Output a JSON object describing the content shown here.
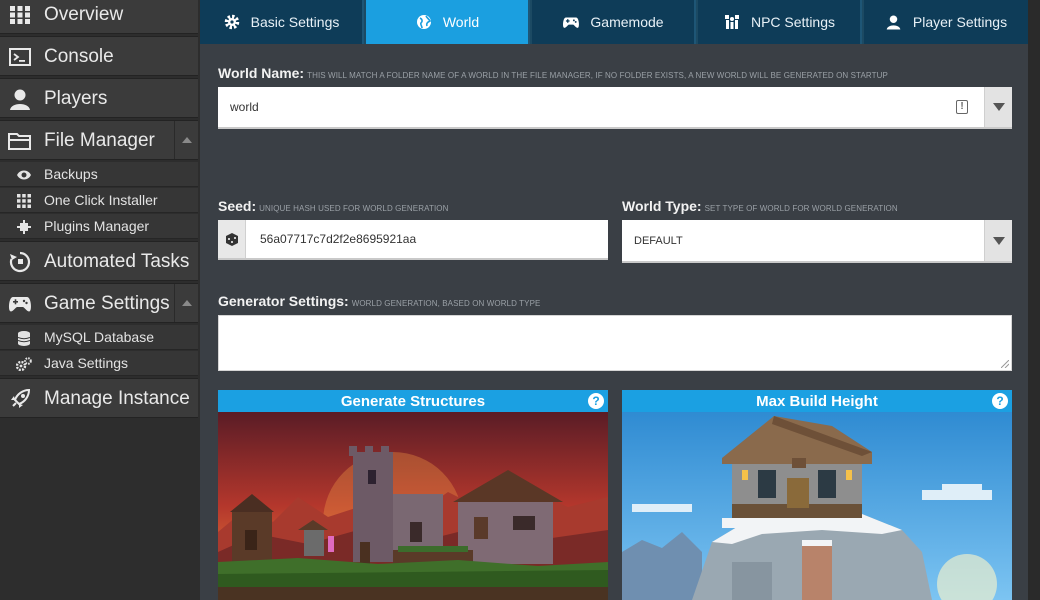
{
  "sidebar": {
    "items": [
      {
        "label": "Overview",
        "icon": "grid-icon"
      },
      {
        "label": "Console",
        "icon": "console-icon"
      },
      {
        "label": "Players",
        "icon": "user-icon"
      },
      {
        "label": "File Manager",
        "icon": "folder-icon"
      },
      {
        "label": "Automated Tasks",
        "icon": "tasks-icon"
      },
      {
        "label": "Game Settings",
        "icon": "gamepad-icon"
      },
      {
        "label": "Manage Instance",
        "icon": "rocket-icon"
      }
    ],
    "file_manager_sub": [
      {
        "label": "Backups",
        "icon": "eye-icon"
      },
      {
        "label": "One Click Installer",
        "icon": "grid-icon"
      },
      {
        "label": "Plugins Manager",
        "icon": "plug-icon"
      }
    ],
    "game_settings_sub": [
      {
        "label": "MySQL Database",
        "icon": "database-icon"
      },
      {
        "label": "Java Settings",
        "icon": "cogs-icon"
      }
    ]
  },
  "tabs": [
    {
      "label": "Basic Settings",
      "icon": "cog-icon",
      "active": false
    },
    {
      "label": "World",
      "icon": "globe-icon",
      "active": true
    },
    {
      "label": "Gamemode",
      "icon": "gamepad-icon",
      "active": false
    },
    {
      "label": "NPC Settings",
      "icon": "npc-icon",
      "active": false
    },
    {
      "label": "Player Settings",
      "icon": "user-icon",
      "active": false
    }
  ],
  "world_name": {
    "label": "World Name:",
    "hint": "THIS WILL MATCH A FOLDER NAME OF A WORLD IN THE FILE MANAGER, IF NO FOLDER EXISTS, A NEW WORLD WILL BE GENERATED ON STARTUP",
    "value": "world"
  },
  "seed": {
    "label": "Seed:",
    "hint": "UNIQUE HASH USED FOR WORLD GENERATION",
    "value": "56a07717c7d2f2e8695921aa"
  },
  "world_type": {
    "label": "World Type:",
    "hint": "SET TYPE OF WORLD FOR WORLD GENERATION",
    "value": "DEFAULT"
  },
  "generator": {
    "label": "Generator Settings:",
    "hint": "WORLD GENERATION, BASED ON WORLD TYPE",
    "value": ""
  },
  "cards": [
    {
      "title": "Generate Structures"
    },
    {
      "title": "Max Build Height"
    }
  ],
  "colors": {
    "accent": "#1ba0e2",
    "tab_bg": "#0e3c58",
    "main_bg": "#3a3f45",
    "sidebar_bg": "#3b3b3b"
  }
}
